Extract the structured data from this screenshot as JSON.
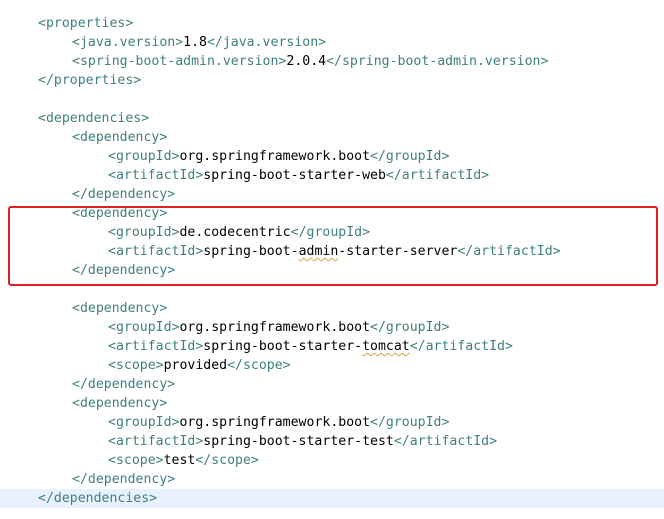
{
  "properties": {
    "open": "<properties>",
    "java_version": {
      "open": "<java.version>",
      "value": "1.8",
      "close": "</java.version>"
    },
    "sba_version": {
      "open": "<spring-boot-admin.version>",
      "value": "2.0.4",
      "close": "</spring-boot-admin.version>"
    },
    "close": "</properties>"
  },
  "dependencies": {
    "open": "<dependencies>",
    "close": "</dependencies>",
    "dep_open": "<dependency>",
    "dep_close": "</dependency>",
    "items": [
      {
        "groupId": {
          "open": "<groupId>",
          "value": "org.springframework.boot",
          "close": "</groupId>"
        },
        "artifactId": {
          "open": "<artifactId>",
          "value": "spring-boot-starter-web",
          "close": "</artifactId>"
        }
      },
      {
        "groupId": {
          "open": "<groupId>",
          "value": "de.codecentric",
          "close": "</groupId>"
        },
        "artifactId": {
          "open": "<artifactId>",
          "value_pre": "spring-boot-",
          "value_squiggle": "admin",
          "value_post": "-starter-server",
          "close": "</artifactId>"
        }
      },
      {
        "groupId": {
          "open": "<groupId>",
          "value": "org.springframework.boot",
          "close": "</groupId>"
        },
        "artifactId": {
          "open": "<artifactId>",
          "value_pre": "spring-boot-starter-",
          "value_squiggle": "tomcat",
          "close": "</artifactId>"
        },
        "scope": {
          "open": "<scope>",
          "value": "provided",
          "close": "</scope>"
        }
      },
      {
        "groupId": {
          "open": "<groupId>",
          "value": "org.springframework.boot",
          "close": "</groupId>"
        },
        "artifactId": {
          "open": "<artifactId>",
          "value": "spring-boot-starter-test",
          "close": "</artifactId>"
        },
        "scope": {
          "open": "<scope>",
          "value": "test",
          "close": "</scope>"
        }
      }
    ]
  },
  "colors": {
    "tag": "#3f7f7f",
    "text": "#000000",
    "current_line": "#e8f2fe",
    "highlight_border": "#e02020",
    "squiggle": "#d9a441"
  }
}
